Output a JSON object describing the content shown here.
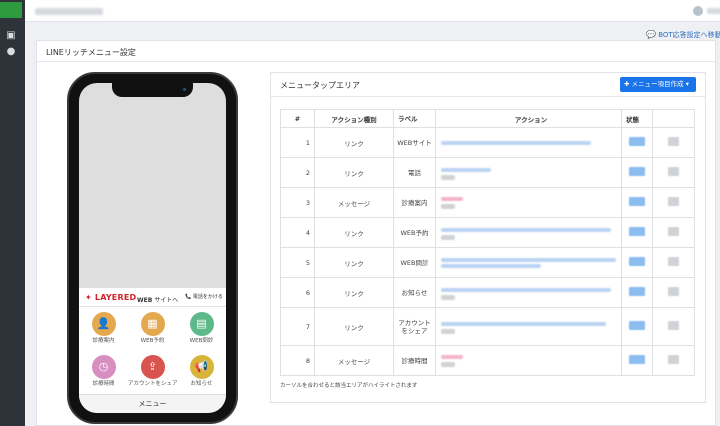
{
  "sidebar": {
    "nav": [
      {
        "icon": "menu-square-icon"
      },
      {
        "icon": "user-icon"
      }
    ]
  },
  "header": {
    "bot_link": "BOT応答設定へ移動"
  },
  "page": {
    "title": "LINEリッチメニュー設定"
  },
  "rich_menu": {
    "banner_logo": "LAYERED",
    "banner_web": "WEB",
    "banner_web_sub": "サイトへ",
    "banner_phone": "電話をかける",
    "items": [
      {
        "label": "診療案内",
        "color": "#e4a84f",
        "icon": "person-icon"
      },
      {
        "label": "WEB予約",
        "color": "#e4a84f",
        "icon": "calendar-icon"
      },
      {
        "label": "WEB問診",
        "color": "#5db88a",
        "icon": "clipboard-icon"
      },
      {
        "label": "診療時間",
        "color": "#d78fc1",
        "icon": "clock-icon"
      },
      {
        "label": "アカウントをシェア",
        "color": "#d9534f",
        "icon": "share-icon"
      },
      {
        "label": "お知らせ",
        "color": "#d8b43a",
        "icon": "megaphone-icon"
      }
    ],
    "menu_label": "メニュー"
  },
  "tap_area": {
    "title": "メニュータップエリア",
    "add_button": "メニュー項目作成",
    "headers": {
      "num": "#",
      "type": "アクション種別",
      "label": "ラベル",
      "action": "アクション",
      "status": "状態"
    },
    "rows": [
      {
        "num": "1",
        "type": "リンク",
        "label": "WEBサイト"
      },
      {
        "num": "2",
        "type": "リンク",
        "label": "電話"
      },
      {
        "num": "3",
        "type": "メッセージ",
        "label": "診療案内"
      },
      {
        "num": "4",
        "type": "リンク",
        "label": "WEB予約"
      },
      {
        "num": "5",
        "type": "リンク",
        "label": "WEB問診"
      },
      {
        "num": "6",
        "type": "リンク",
        "label": "お知らせ"
      },
      {
        "num": "7",
        "type": "リンク",
        "label": "アカウントをシェア"
      },
      {
        "num": "8",
        "type": "メッセージ",
        "label": "診療時間"
      }
    ],
    "note": "カーソルを合わせると該当エリアがハイライトされます"
  }
}
